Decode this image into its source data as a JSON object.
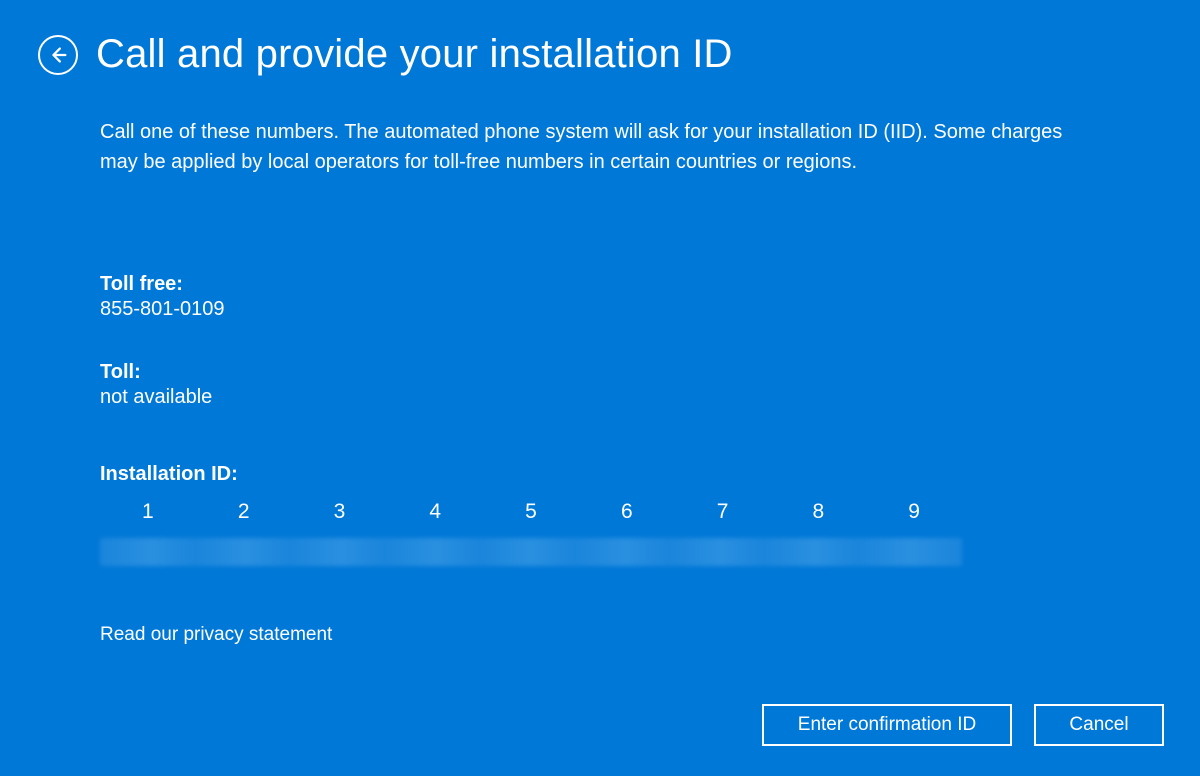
{
  "header": {
    "title": "Call and provide your installation ID"
  },
  "description": "Call one of these numbers. The automated phone system will ask for your installation ID (IID). Some charges may be applied by local operators for toll-free numbers in certain countries or regions.",
  "toll_free": {
    "label": "Toll free:",
    "value": "855-801-0109"
  },
  "toll": {
    "label": "Toll:",
    "value": "not available"
  },
  "installation": {
    "label": "Installation ID:",
    "columns": [
      "1",
      "2",
      "3",
      "4",
      "5",
      "6",
      "7",
      "8",
      "9"
    ]
  },
  "privacy_link": "Read our privacy statement",
  "buttons": {
    "enter_confirmation": "Enter confirmation ID",
    "cancel": "Cancel"
  }
}
